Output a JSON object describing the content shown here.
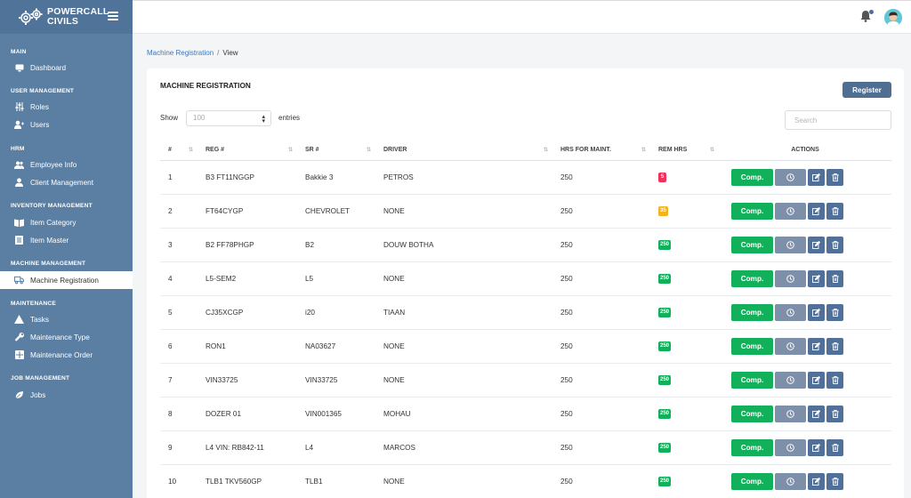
{
  "brand": {
    "line1": "POWERCALL",
    "line2": "CIVILS"
  },
  "sidebar": {
    "sections": [
      {
        "title": "MAIN",
        "items": [
          {
            "label": "Dashboard",
            "icon": "monitor-icon"
          }
        ]
      },
      {
        "title": "USER MANAGEMENT",
        "items": [
          {
            "label": "Roles",
            "icon": "sliders-icon"
          },
          {
            "label": "Users",
            "icon": "user-plus-icon"
          }
        ]
      },
      {
        "title": "HRM",
        "items": [
          {
            "label": "Employee Info",
            "icon": "users-icon"
          },
          {
            "label": "Client Management",
            "icon": "user-icon"
          }
        ]
      },
      {
        "title": "INVENTORY MANAGEMENT",
        "items": [
          {
            "label": "Item Category",
            "icon": "book-icon"
          },
          {
            "label": "Item Master",
            "icon": "list-icon"
          }
        ]
      },
      {
        "title": "MACHINE MANAGEMENT",
        "items": [
          {
            "label": "Machine Registration",
            "icon": "truck-icon",
            "active": true
          }
        ]
      },
      {
        "title": "MAINTENANCE",
        "items": [
          {
            "label": "Tasks",
            "icon": "warning-icon"
          },
          {
            "label": "Maintenance Type",
            "icon": "wrench-icon"
          },
          {
            "label": "Maintenance Order",
            "icon": "grid-icon"
          }
        ]
      },
      {
        "title": "JOB MANAGEMENT",
        "items": [
          {
            "label": "Jobs",
            "icon": "leaf-icon"
          }
        ]
      }
    ]
  },
  "breadcrumb": {
    "link": "Machine Registration",
    "separator": "/",
    "current": "View"
  },
  "card": {
    "title": "MACHINE REGISTRATION",
    "register_label": "Register",
    "show_label": "Show",
    "entries_value": "100",
    "entries_label": "entries",
    "search_placeholder": "Search"
  },
  "table": {
    "headers": [
      "#",
      "REG #",
      "SR #",
      "DRIVER",
      "HRS FOR MAINT.",
      "REM HRS",
      "ACTIONS"
    ],
    "comp_label": "Comp.",
    "rows": [
      {
        "num": "1",
        "reg": "B3 FT11NGGP",
        "sr": "Bakkie 3",
        "driver": "PETROS",
        "hrs": "250",
        "rem": "5",
        "status": "danger"
      },
      {
        "num": "2",
        "reg": "FT64CYGP",
        "sr": "CHEVROLET",
        "driver": "NONE",
        "hrs": "250",
        "rem": "35",
        "status": "warning"
      },
      {
        "num": "3",
        "reg": "B2 FF78PHGP",
        "sr": "B2",
        "driver": "DOUW BOTHA",
        "hrs": "250",
        "rem": "250",
        "status": "success"
      },
      {
        "num": "4",
        "reg": "L5-SEM2",
        "sr": "L5",
        "driver": "NONE",
        "hrs": "250",
        "rem": "250",
        "status": "success"
      },
      {
        "num": "5",
        "reg": "CJ35XCGP",
        "sr": "i20",
        "driver": "TIAAN",
        "hrs": "250",
        "rem": "250",
        "status": "success"
      },
      {
        "num": "6",
        "reg": "RON1",
        "sr": "NA03627",
        "driver": "NONE",
        "hrs": "250",
        "rem": "250",
        "status": "success"
      },
      {
        "num": "7",
        "reg": "VIN33725",
        "sr": "VIN33725",
        "driver": "NONE",
        "hrs": "250",
        "rem": "250",
        "status": "success"
      },
      {
        "num": "8",
        "reg": "DOZER 01",
        "sr": "VIN001365",
        "driver": "MOHAU",
        "hrs": "250",
        "rem": "250",
        "status": "success"
      },
      {
        "num": "9",
        "reg": "L4 VIN: RB842-11",
        "sr": "L4",
        "driver": "MARCOS",
        "hrs": "250",
        "rem": "250",
        "status": "success"
      },
      {
        "num": "10",
        "reg": "TLB1 TKV560GP",
        "sr": "TLB1",
        "driver": "NONE",
        "hrs": "250",
        "rem": "250",
        "status": "success"
      }
    ]
  },
  "colors": {
    "sidebar": "#5b7fa3",
    "comp": "#12b05a",
    "danger": "#f0325a",
    "warning": "#f5b319",
    "primary": "#4f6e91"
  }
}
